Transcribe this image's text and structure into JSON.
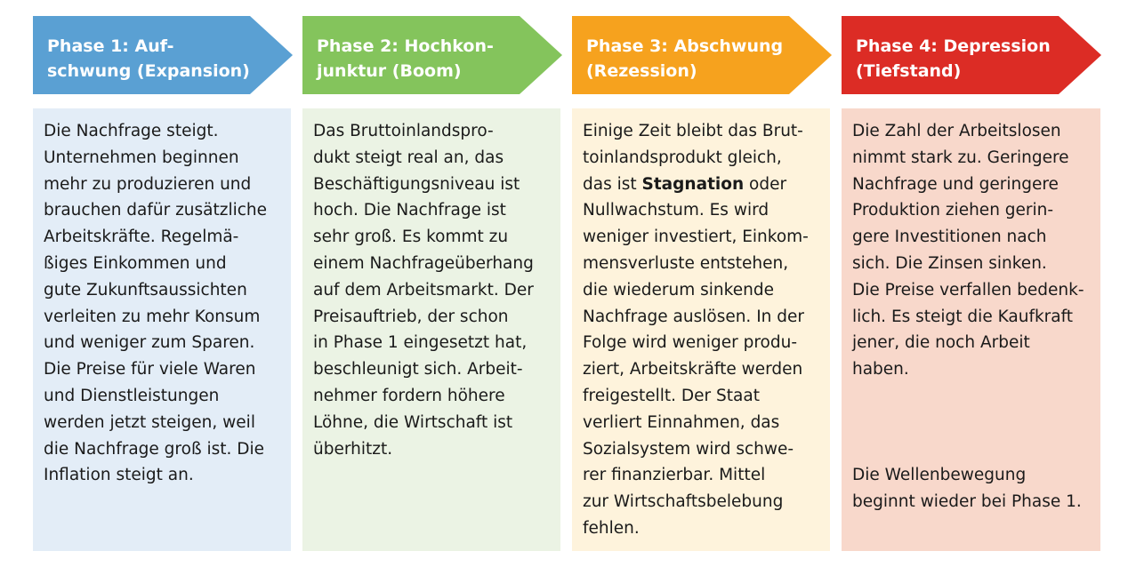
{
  "colors": {
    "phase1_header": "#5aa0d3",
    "phase1_body": "#e3edf7",
    "phase2_header": "#84c45c",
    "phase2_body": "#ebf3e4",
    "phase3_header": "#f6a21e",
    "phase3_body": "#fef3dc",
    "phase4_header": "#dc2c25",
    "phase4_body": "#f8d8cb"
  },
  "phases": [
    {
      "title": "Phase 1: Auf-\nschwung (Expansion)",
      "lines": [
        "Die Nachfrage steigt.",
        "Unternehmen beginnen",
        "mehr zu produzieren und",
        "brauchen dafür zusätzliche",
        "Arbeitskräfte. Regelmä-",
        "ßiges Einkommen und",
        "gute Zukunftsaussichten",
        "verleiten zu mehr Konsum",
        "und weniger zum Sparen.",
        "Die Preise für viele Waren",
        "und Dienstleistungen",
        "werden jetzt steigen, weil",
        "die Nachfrage groß ist. Die",
        "Inflation steigt an."
      ]
    },
    {
      "title": "Phase 2: Hochkon-\njunktur (Boom)",
      "lines": [
        "Das Bruttoinlandspro-",
        "dukt steigt real an, das",
        "Beschäftigungsniveau ist",
        "hoch. Die Nachfrage ist",
        "sehr groß. Es kommt zu",
        "einem Nachfrageüberhang",
        "auf dem Arbeitsmarkt. Der",
        "Preisauftrieb, der schon",
        "in Phase 1 eingesetzt hat,",
        "beschleunigt sich. Arbeit-",
        "nehmer fordern höhere",
        "Löhne, die Wirtschaft ist",
        "überhitzt."
      ]
    },
    {
      "title": "Phase 3: Abschwung\n(Rezession)",
      "lines_before_bold": [
        "Einige Zeit bleibt das Brut-",
        "toinlandsprodukt gleich,"
      ],
      "bold_line_prefix": "das ist ",
      "bold_term": "Stagnation",
      "bold_line_suffix": " oder",
      "lines_after_bold": [
        "Nullwachstum. Es wird",
        "weniger investiert, Einkom-",
        "mensverluste entstehen,",
        "die wiederum sinkende",
        "Nachfrage auslösen. In der",
        "Folge wird weniger produ-",
        "ziert, Arbeitskräfte werden",
        "freigestellt. Der Staat",
        "verliert Einnahmen, das",
        "Sozialsystem wird schwe-",
        "rer finanzierbar. Mittel",
        "zur Wirtschaftsbelebung",
        "fehlen."
      ]
    },
    {
      "title": "Phase 4: Depression\n(Tiefstand)",
      "lines": [
        "Die Zahl der Arbeitslosen",
        "nimmt stark zu. Geringere",
        "Nachfrage und geringere",
        "Produktion ziehen gerin-",
        "gere Investitionen nach",
        "sich. Die Zinsen sinken.",
        "Die Preise verfallen bedenk-",
        "lich. Es steigt die Kaufkraft",
        "jener, die noch Arbeit",
        "haben."
      ],
      "closing_lines": [
        "Die Wellenbewegung",
        "beginnt wieder bei Phase 1."
      ]
    }
  ]
}
